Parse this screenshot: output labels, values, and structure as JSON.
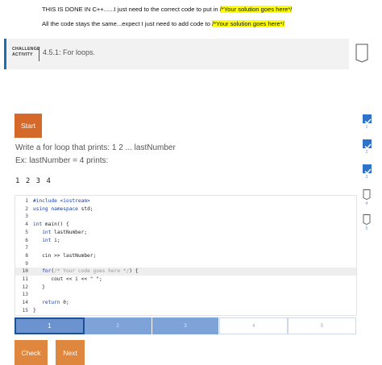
{
  "notes": {
    "line1_prefix": "THIS IS DONE IN C++......I just need to the correct code to put in ",
    "line1_highlight": "/*Your solution goes here*/",
    "line2_prefix": "All the code stays the same...expect I just need to add code to ",
    "line2_highlight": "/*Your solution goes here*/"
  },
  "header": {
    "label_line1": "CHALLENGE",
    "label_line2": "ACTIVITY",
    "title": "4.5.1: For loops."
  },
  "start_label": "Start",
  "prompt": {
    "line1": "Write a for loop that prints: 1 2 ... lastNumber",
    "line2": "Ex: lastNumber = 4 prints:",
    "output": "1 2 3 4"
  },
  "code_lines": [
    {
      "n": "1",
      "text": "#include <iostream>"
    },
    {
      "n": "2",
      "text": "using namespace std;"
    },
    {
      "n": "3",
      "text": ""
    },
    {
      "n": "4",
      "text": "int main() {"
    },
    {
      "n": "5",
      "text": "   int lastNumber;"
    },
    {
      "n": "6",
      "text": "   int i;"
    },
    {
      "n": "7",
      "text": ""
    },
    {
      "n": "8",
      "text": "   cin >> lastNumber;"
    },
    {
      "n": "9",
      "text": ""
    },
    {
      "n": "10",
      "text": "   for(/* Your code goes here */) {"
    },
    {
      "n": "11",
      "text": "      cout << i << \" \";"
    },
    {
      "n": "12",
      "text": "   }"
    },
    {
      "n": "13",
      "text": ""
    },
    {
      "n": "14",
      "text": "   return 0;"
    },
    {
      "n": "15",
      "text": "}"
    }
  ],
  "progress": [
    {
      "label": "1",
      "state": "current"
    },
    {
      "label": "2",
      "state": "done"
    },
    {
      "label": "3",
      "state": "done"
    },
    {
      "label": "4",
      "state": "todo"
    },
    {
      "label": "5",
      "state": "todo"
    }
  ],
  "buttons": {
    "check": "Check",
    "next": "Next"
  },
  "levels": [
    {
      "num": "1",
      "done": true
    },
    {
      "num": "2",
      "done": true
    },
    {
      "num": "3",
      "done": true
    },
    {
      "num": "4",
      "done": false
    },
    {
      "num": "5",
      "done": false
    }
  ],
  "colors": {
    "accent_orange": "#d4692a",
    "progress_blue": "#6a93d0",
    "check_blue": "#2d73c9",
    "highlight_yellow": "#ffff00"
  }
}
